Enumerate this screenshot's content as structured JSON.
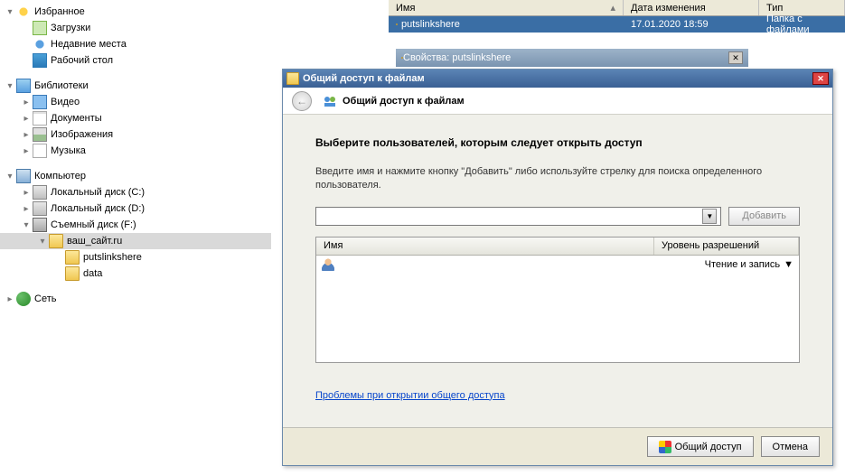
{
  "tree": {
    "favorites": "Избранное",
    "downloads": "Загрузки",
    "recent": "Недавние места",
    "desktop": "Рабочий стол",
    "libraries": "Библиотеки",
    "video": "Видео",
    "documents": "Документы",
    "images": "Изображения",
    "music": "Музыка",
    "computer": "Компьютер",
    "drive_c": "Локальный диск (C:)",
    "drive_d": "Локальный диск (D:)",
    "drive_f": "Съемный диск (F:)",
    "site": "ваш_сайт.ru",
    "putslinkshere": "putslinkshere",
    "data": "data",
    "network": "Сеть"
  },
  "filelist": {
    "cols": {
      "name": "Имя",
      "date": "Дата изменения",
      "type": "Тип"
    },
    "rows": [
      {
        "name": "putslinkshere",
        "date": "17.01.2020 18:59",
        "type": "Папка с файлами"
      }
    ]
  },
  "props": {
    "title": "Свойства: putslinkshere"
  },
  "dialog": {
    "title": "Общий доступ к файлам",
    "heading": "Общий доступ к файлам",
    "subheading": "Выберите пользователей, которым следует открыть доступ",
    "instruction": "Введите имя и нажмите кнопку \"Добавить\" либо используйте стрелку для поиска определенного пользователя.",
    "add_btn": "Добавить",
    "cols": {
      "name": "Имя",
      "level": "Уровень разрешений"
    },
    "user_level": "Чтение и запись",
    "trouble_link": "Проблемы при открытии общего доступа",
    "share_btn": "Общий доступ",
    "cancel_btn": "Отмена"
  }
}
